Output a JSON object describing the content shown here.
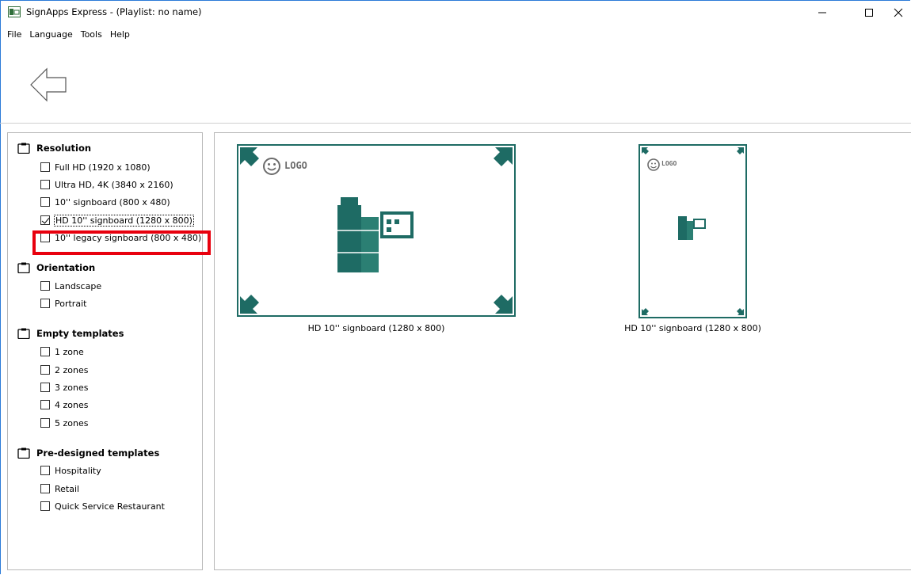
{
  "window": {
    "title": "SignApps Express - (Playlist: no name)",
    "minimize_icon": "minimize-icon",
    "maximize_icon": "maximize-icon",
    "close_icon": "close-icon"
  },
  "menu": {
    "items": [
      {
        "label": "File"
      },
      {
        "label": "Language"
      },
      {
        "label": "Tools"
      },
      {
        "label": "Help"
      }
    ]
  },
  "toolbar": {
    "back_icon": "back-arrow-icon"
  },
  "filters": {
    "groups": [
      {
        "title": "Resolution",
        "options": [
          {
            "label": "Full HD (1920 x 1080)",
            "checked": false
          },
          {
            "label": "Ultra HD, 4K (3840 x 2160)",
            "checked": false
          },
          {
            "label": "10'' signboard (800 x 480)",
            "checked": false
          },
          {
            "label": "HD 10'' signboard (1280 x 800)",
            "checked": true
          },
          {
            "label": "10'' legacy signboard (800 x 480)",
            "checked": false
          }
        ]
      },
      {
        "title": "Orientation",
        "options": [
          {
            "label": "Landscape",
            "checked": false
          },
          {
            "label": "Portrait",
            "checked": false
          }
        ]
      },
      {
        "title": "Empty templates",
        "options": [
          {
            "label": "1 zone",
            "checked": false
          },
          {
            "label": "2 zones",
            "checked": false
          },
          {
            "label": "3 zones",
            "checked": false
          },
          {
            "label": "4 zones",
            "checked": false
          },
          {
            "label": "5 zones",
            "checked": false
          }
        ]
      },
      {
        "title": "Pre-designed templates",
        "options": [
          {
            "label": "Hospitality",
            "checked": false
          },
          {
            "label": "Retail",
            "checked": false
          },
          {
            "label": "Quick Service Restaurant",
            "checked": false
          }
        ]
      }
    ]
  },
  "templates": [
    {
      "caption": "HD 10'' signboard (1280 x 800)",
      "logo_text": "LOGO",
      "orientation": "landscape"
    },
    {
      "caption": "HD 10'' signboard (1280 x 800)",
      "logo_text": "LOGO",
      "orientation": "portrait"
    }
  ],
  "colors": {
    "template_border": "#1e6b64",
    "highlight": "#e8000e",
    "window_border": "#2b7bd8"
  }
}
